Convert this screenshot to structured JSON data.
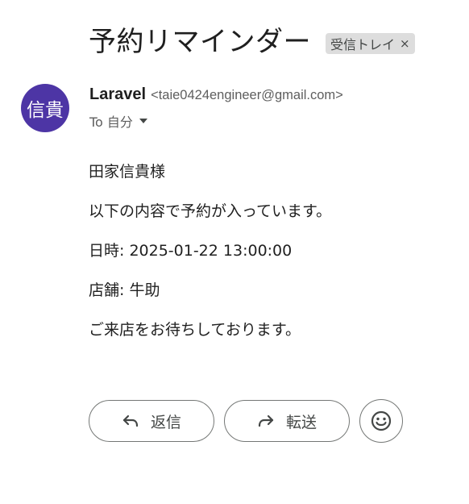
{
  "email": {
    "subject": "予約リマインダー",
    "label": "受信トレイ",
    "label_close": "×",
    "avatar_text": "信貴",
    "avatar_color": "#4d35a5",
    "sender_name": "Laravel",
    "sender_email": "<taie0424engineer@gmail.com>",
    "to_text": "To 自分",
    "body_lines": [
      "田家信貴様",
      "以下の内容で予約が入っています。",
      "日時: 2025-01-22 13:00:00",
      "店舗: 牛助",
      "ご来店をお待ちしております。"
    ]
  },
  "actions": {
    "reply_label": "返信",
    "forward_label": "転送",
    "reply_icon": "reply-arrow-icon",
    "forward_icon": "forward-arrow-icon",
    "emoji_icon": "smiley-face-icon"
  }
}
